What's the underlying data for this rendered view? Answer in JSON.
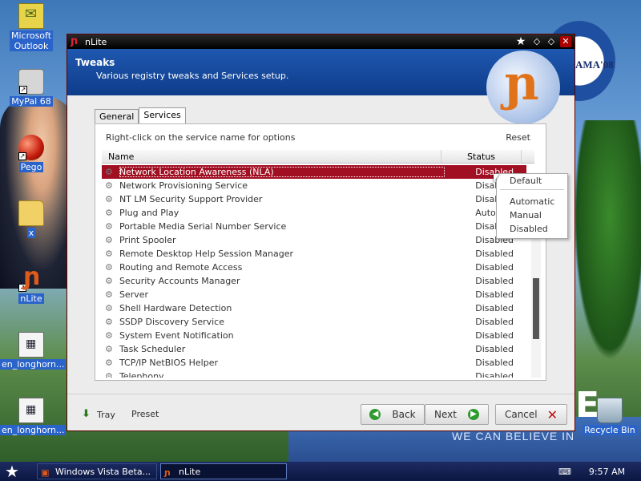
{
  "desktop": {
    "icons": [
      {
        "label_line1": "Microsoft",
        "label_line2": "Outlook",
        "icon": "outlook-icon"
      },
      {
        "label": "MyPal 68",
        "icon": "mypal-icon"
      },
      {
        "label": "Pego",
        "icon": "pego-icon"
      },
      {
        "label": "x",
        "icon": "folder-icon"
      },
      {
        "label": "nLite",
        "icon": "nlite-icon"
      },
      {
        "label": "en_longhorn...",
        "icon": "file-icon"
      },
      {
        "label": "en_longhorn...",
        "icon": "file-icon"
      },
      {
        "label": "Recycle Bin",
        "icon": "recycle-bin-icon"
      }
    ],
    "wallpaper_text": {
      "logo": "AMA'08",
      "letter": "E",
      "slogan": "WE CAN BELIEVE IN"
    }
  },
  "window": {
    "title": "nLite",
    "header": {
      "title": "Tweaks",
      "subtitle": "Various registry tweaks and Services setup."
    },
    "tabs": [
      {
        "label": "General"
      },
      {
        "label": "Services"
      }
    ],
    "active_tab": "Services",
    "panel": {
      "hint": "Right-click on the service name for options",
      "reset_label": "Reset",
      "columns": {
        "name": "Name",
        "status": "Status"
      },
      "rows": [
        {
          "name": "Network Location Awareness (NLA)",
          "status": "Disabled"
        },
        {
          "name": "Network Provisioning Service",
          "status": "Disabled"
        },
        {
          "name": "NT LM Security Support Provider",
          "status": "Disabled"
        },
        {
          "name": "Plug and Play",
          "status": "Automatic"
        },
        {
          "name": "Portable Media Serial Number Service",
          "status": "Disabled"
        },
        {
          "name": "Print Spooler",
          "status": "Disabled"
        },
        {
          "name": "Remote Desktop Help Session Manager",
          "status": "Disabled"
        },
        {
          "name": "Routing and Remote Access",
          "status": "Disabled"
        },
        {
          "name": "Security Accounts Manager",
          "status": "Disabled"
        },
        {
          "name": "Server",
          "status": "Disabled"
        },
        {
          "name": "Shell Hardware Detection",
          "status": "Disabled"
        },
        {
          "name": "SSDP Discovery Service",
          "status": "Disabled"
        },
        {
          "name": "System Event Notification",
          "status": "Disabled"
        },
        {
          "name": "Task Scheduler",
          "status": "Disabled"
        },
        {
          "name": "TCP/IP NetBIOS Helper",
          "status": "Disabled"
        },
        {
          "name": "Telephony",
          "status": "Disabled"
        }
      ],
      "selected_row": "Network Location Awareness (NLA)"
    },
    "context_menu": {
      "items": [
        "Default",
        "Automatic",
        "Manual",
        "Disabled"
      ]
    },
    "footer": {
      "tray_label": "Tray",
      "preset_label": "Preset",
      "back_label": "Back",
      "next_label": "Next",
      "cancel_label": "Cancel"
    }
  },
  "taskbar": {
    "tasks": [
      {
        "label": "Windows Vista Beta..."
      },
      {
        "label": "nLite"
      }
    ],
    "clock": "9:57 AM"
  },
  "colors": {
    "selection": "#a10f22",
    "header_blue": "#1f58b0",
    "taskbar": "#0b1740"
  }
}
